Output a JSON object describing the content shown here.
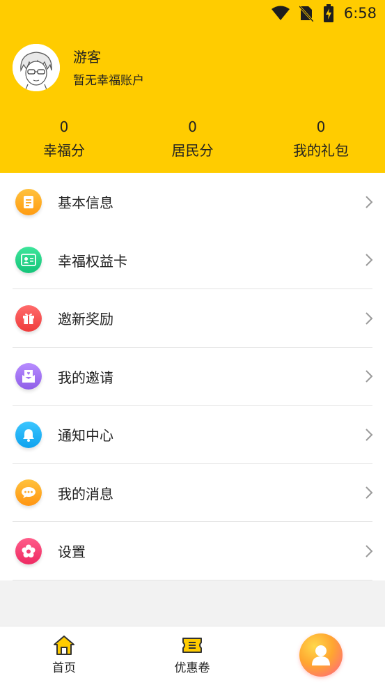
{
  "status_bar": {
    "time": "6:58"
  },
  "user": {
    "name": "游客",
    "subtitle": "暂无幸福账户"
  },
  "stats": [
    {
      "value": "0",
      "label": "幸福分"
    },
    {
      "value": "0",
      "label": "居民分"
    },
    {
      "value": "0",
      "label": "我的礼包"
    }
  ],
  "menu": [
    {
      "label": "基本信息",
      "icon": "document-icon",
      "color": "#ffb21f"
    },
    {
      "label": "幸福权益卡",
      "icon": "id-card-icon",
      "color": "#1ecf86"
    },
    {
      "label": "邀新奖励",
      "icon": "gift-icon",
      "color": "#f75454"
    },
    {
      "label": "我的邀请",
      "icon": "envelope-icon",
      "color": "#a477f2"
    },
    {
      "label": "通知中心",
      "icon": "bell-icon",
      "color": "#1eb4f5"
    },
    {
      "label": "我的消息",
      "icon": "chat-icon",
      "color": "#ffa51f"
    },
    {
      "label": "设置",
      "icon": "flower-icon",
      "color": "#f53e74"
    }
  ],
  "tabs": [
    {
      "label": "首页",
      "icon": "home-icon"
    },
    {
      "label": "优惠卷",
      "icon": "ticket-icon"
    },
    {
      "label": "",
      "icon": "profile-icon"
    }
  ],
  "colors": {
    "header_bg": "#ffcc00",
    "accent": "#ffcc00"
  }
}
